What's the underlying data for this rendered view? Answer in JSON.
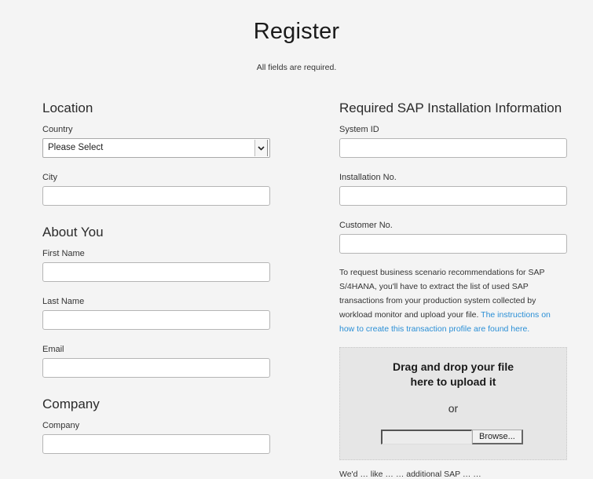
{
  "header": {
    "title": "Register",
    "subtitle": "All fields are required."
  },
  "location": {
    "section_title": "Location",
    "country_label": "Country",
    "country_value": "Please Select",
    "city_label": "City",
    "city_value": ""
  },
  "about": {
    "section_title": "About You",
    "first_name_label": "First Name",
    "last_name_label": "Last Name",
    "email_label": "Email"
  },
  "company": {
    "section_title": "Company",
    "company_label": "Company"
  },
  "sap": {
    "section_title": "Required SAP Installation Information",
    "system_id_label": "System ID",
    "installation_no_label": "Installation No.",
    "customer_no_label": "Customer No.",
    "description": "To request business scenario recommendations for SAP S/4HANA, you'll have to extract the list of used SAP transactions from your production system collected by workload monitor and upload your file. ",
    "link_text": "The instructions on how to create this transaction profile are found here."
  },
  "upload": {
    "title_line1": "Drag and drop your file",
    "title_line2": "here to upload it",
    "or_text": "or",
    "file_value": "",
    "browse_label": "Browse..."
  },
  "footer_cutoff": "We'd … like … … additional SAP … …"
}
